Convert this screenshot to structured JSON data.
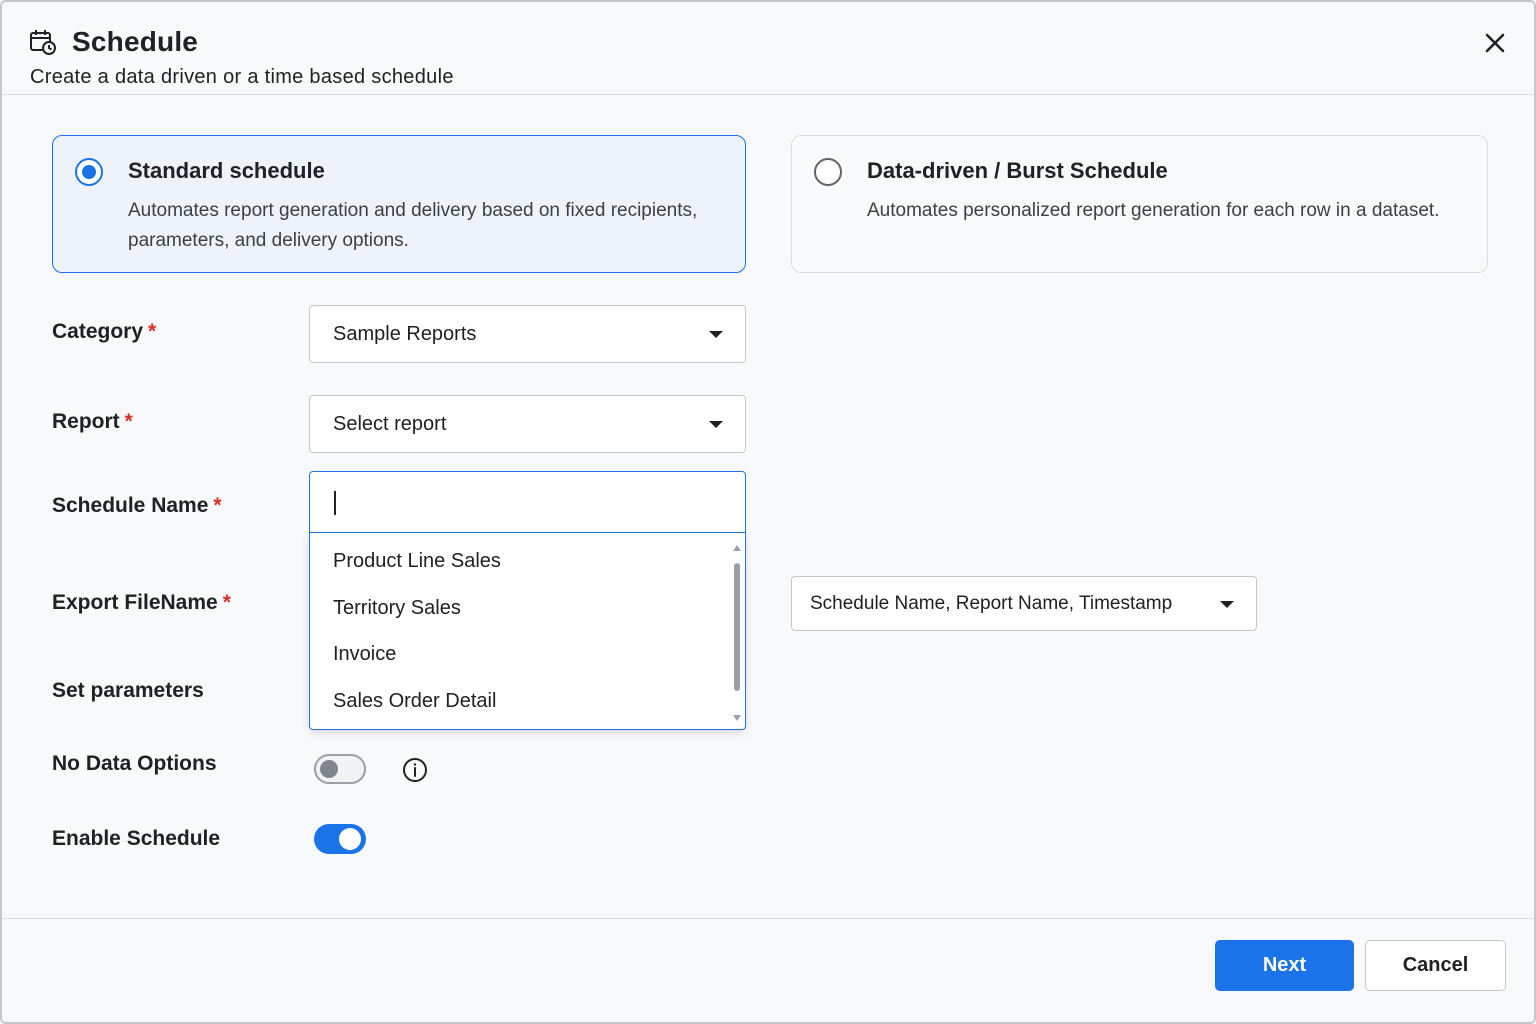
{
  "header": {
    "title": "Schedule",
    "subtitle": "Create a data driven or a time based schedule"
  },
  "schedule_types": [
    {
      "title": "Standard schedule",
      "description": "Automates report generation and delivery based on fixed recipients, parameters, and delivery options.",
      "selected": true
    },
    {
      "title": "Data-driven / Burst Schedule",
      "description": "Automates personalized report generation for each row in a dataset.",
      "selected": false
    }
  ],
  "form": {
    "required_mark": "*",
    "category": {
      "label": "Category",
      "value": "Sample Reports"
    },
    "report": {
      "label": "Report",
      "value": "Select report"
    },
    "schedule_name": {
      "label": "Schedule Name",
      "value": ""
    },
    "export_filename": {
      "label": "Export FileName",
      "value": "Schedule Name, Report Name, Timestamp"
    },
    "set_parameters": {
      "label": "Set parameters"
    },
    "no_data_options": {
      "label": "No Data Options",
      "enabled": false
    },
    "enable_schedule": {
      "label": "Enable Schedule",
      "enabled": true
    }
  },
  "report_dropdown": {
    "items": [
      "Product Line Sales",
      "Territory Sales",
      "Invoice",
      "Sales Order Detail"
    ]
  },
  "footer": {
    "next_label": "Next",
    "cancel_label": "Cancel"
  },
  "colors": {
    "accent": "#1a73e8",
    "required": "#d93025"
  },
  "icons": {
    "header": "calendar-clock-icon",
    "close": "close-icon",
    "info": "info-icon"
  }
}
